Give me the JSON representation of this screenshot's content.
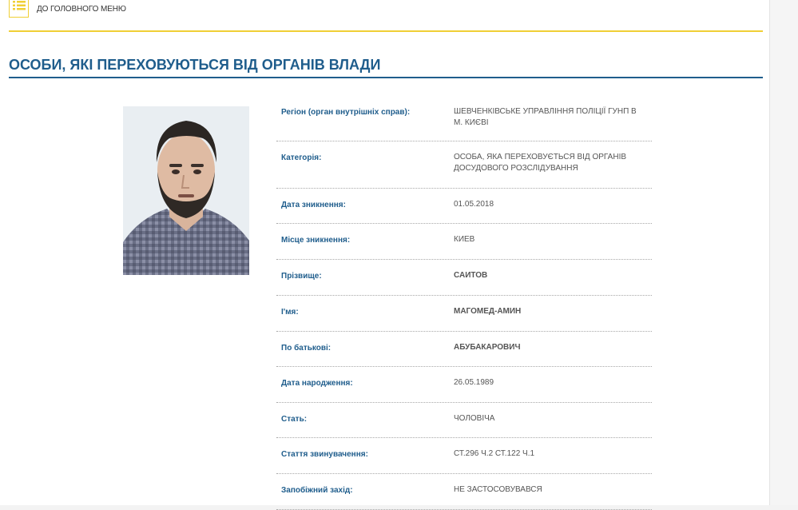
{
  "nav": {
    "back_label": "ДО ГОЛОВНОГО МЕНЮ"
  },
  "page_title": "ОСОБИ, ЯКІ ПЕРЕХОВУЮТЬСЯ ВІД ОРГАНІВ ВЛАДИ",
  "colors": {
    "accent_yellow": "#f0cf36",
    "title_blue": "#1f5d8c"
  },
  "icons": {
    "menu": "list-icon"
  },
  "person": {
    "fields": [
      {
        "label": "Регіон (орган внутрішніх справ):",
        "value": "ШЕВЧЕНКІВСЬКЕ УПРАВЛІННЯ ПОЛІЦІЇ ГУНП В М. КИЄВІ"
      },
      {
        "label": "Категорія:",
        "value": "ОСОБА, ЯКА ПЕРЕХОВУЄТЬСЯ ВІД ОРГАНІВ ДОСУДОВОГО РОЗСЛІДУВАННЯ"
      },
      {
        "label": "Дата зникнення:",
        "value": "01.05.2018"
      },
      {
        "label": "Місце зникнення:",
        "value": "КИЕВ"
      },
      {
        "label": "Прізвище:",
        "value": "САИТОВ"
      },
      {
        "label": "І'мя:",
        "value": "МАГОМЕД-АМИН"
      },
      {
        "label": "По батькові:",
        "value": "АБУБАКАРОВИЧ"
      },
      {
        "label": "Дата народження:",
        "value": "26.05.1989"
      },
      {
        "label": "Стать:",
        "value": "ЧОЛОВІЧА"
      },
      {
        "label": "Стаття звинувачення:",
        "value": "СТ.296 Ч.2 СТ.122 Ч.1"
      },
      {
        "label": "Запобіжний захід:",
        "value": "НЕ ЗАСТОСОВУВАВСЯ"
      }
    ]
  }
}
